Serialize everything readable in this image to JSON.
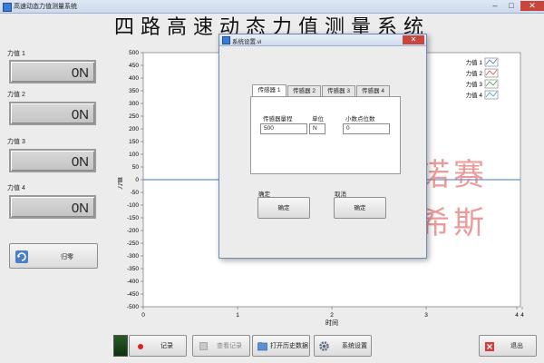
{
  "window": {
    "title": "高速动态力值测量系统"
  },
  "app": {
    "title": "四路高速动态力值测量系统"
  },
  "gauges": [
    {
      "label": "力值 1",
      "value": "0N"
    },
    {
      "label": "力值 2",
      "value": "0N"
    },
    {
      "label": "力值 3",
      "value": "0N"
    },
    {
      "label": "力值 4",
      "value": "0N"
    }
  ],
  "zero_button": {
    "label": "归零"
  },
  "chart_data": {
    "type": "line",
    "ylabel": "力值",
    "xlabel": "时间",
    "ylim": [
      -500,
      500
    ],
    "xlim": [
      0,
      4
    ],
    "y_ticks": [
      "500",
      "450",
      "400",
      "350",
      "300",
      "250",
      "200",
      "150",
      "100",
      "50",
      "0",
      "-50",
      "-100",
      "-150",
      "-200",
      "-250",
      "-300",
      "-350",
      "-400",
      "-450",
      "-500"
    ],
    "x_ticks": [
      "0",
      "1",
      "2",
      "3",
      "4",
      "4"
    ],
    "series": [
      {
        "name": "力值 1",
        "color": "#4a6fd6",
        "x": [
          0,
          4
        ],
        "y": [
          0,
          0
        ]
      },
      {
        "name": "力值 2",
        "color": "#d64a4a",
        "x": [
          0,
          4
        ],
        "y": [
          0,
          0
        ]
      },
      {
        "name": "力值 3",
        "color": "#3aa84a",
        "x": [
          0,
          4
        ],
        "y": [
          0,
          0
        ]
      },
      {
        "name": "力值 4",
        "color": "#3aa0b8",
        "x": [
          0,
          4
        ],
        "y": [
          0,
          0
        ]
      }
    ],
    "legend": "top-right",
    "grid": false
  },
  "bottom": {
    "record": "记录",
    "view_record": "查看记录",
    "open_history": "打开历史数据",
    "settings": "系统设置",
    "exit": "退出"
  },
  "dialog": {
    "title": "系统设置.vi",
    "tabs": [
      "传感器 1",
      "传感器 2",
      "传感器 3",
      "传感器 4"
    ],
    "range_label": "传感器量程",
    "range_value": "500",
    "unit_label": "单位",
    "unit_value": "N",
    "decimals_label": "小数点位数",
    "decimals_value": "0",
    "confirm_label": "确定",
    "confirm_button": "确定",
    "cancel_label": "取消",
    "cancel_button": "确定"
  },
  "watermark": {
    "line1": "诺赛",
    "line2": "希斯"
  }
}
